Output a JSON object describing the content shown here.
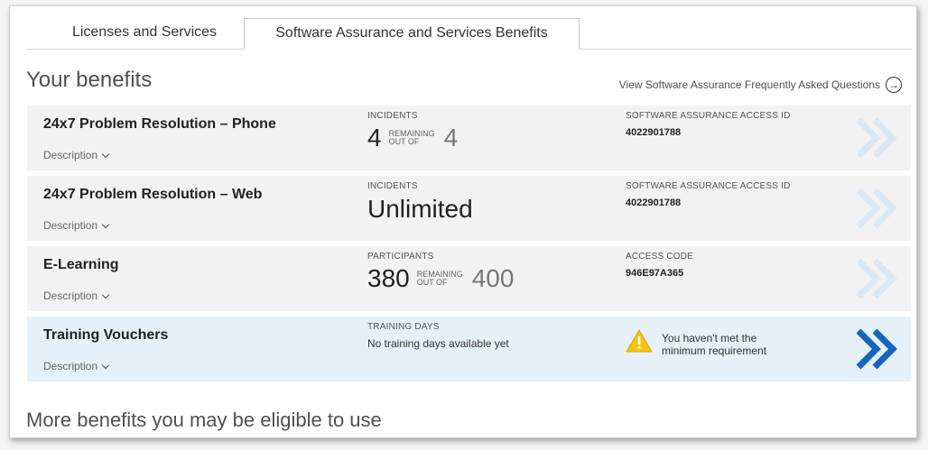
{
  "tabs": [
    {
      "label": "Licenses and Services"
    },
    {
      "label": "Software Assurance and Services Benefits"
    }
  ],
  "header": {
    "title": "Your benefits",
    "faq_link": "View Software Assurance Frequently Asked Questions"
  },
  "benefits": [
    {
      "title": "24x7 Problem Resolution – Phone",
      "description": "Description",
      "metric_label": "INCIDENTS",
      "remaining": "4",
      "remaining_label": "REMAINING",
      "out_of_label": "OUT OF",
      "total": "4",
      "right_label": "SOFTWARE ASSURANCE ACCESS ID",
      "right_value": "4022901788"
    },
    {
      "title": "24x7 Problem Resolution – Web",
      "description": "Description",
      "metric_label": "INCIDENTS",
      "metric_value": "Unlimited",
      "right_label": "SOFTWARE ASSURANCE ACCESS ID",
      "right_value": "4022901788"
    },
    {
      "title": "E-Learning",
      "description": "Description",
      "metric_label": "PARTICIPANTS",
      "remaining": "380",
      "remaining_label": "REMAINING",
      "out_of_label": "OUT OF",
      "total": "400",
      "right_label": "ACCESS CODE",
      "right_value": "946E97A365"
    },
    {
      "title": "Training Vouchers",
      "description": "Description",
      "metric_label": "TRAINING DAYS",
      "metric_text": "No training days available yet",
      "warning_text": "You haven't met the minimum requirement"
    }
  ],
  "footer": {
    "more_benefits": "More benefits you may be eligible to use"
  },
  "colors": {
    "row_bg": "#f2f2f2",
    "highlight_bg": "#e5f0f8",
    "chevron_faded": "#dbe8f3",
    "chevron_active": "#1565c0",
    "warning": "#f5c211"
  }
}
